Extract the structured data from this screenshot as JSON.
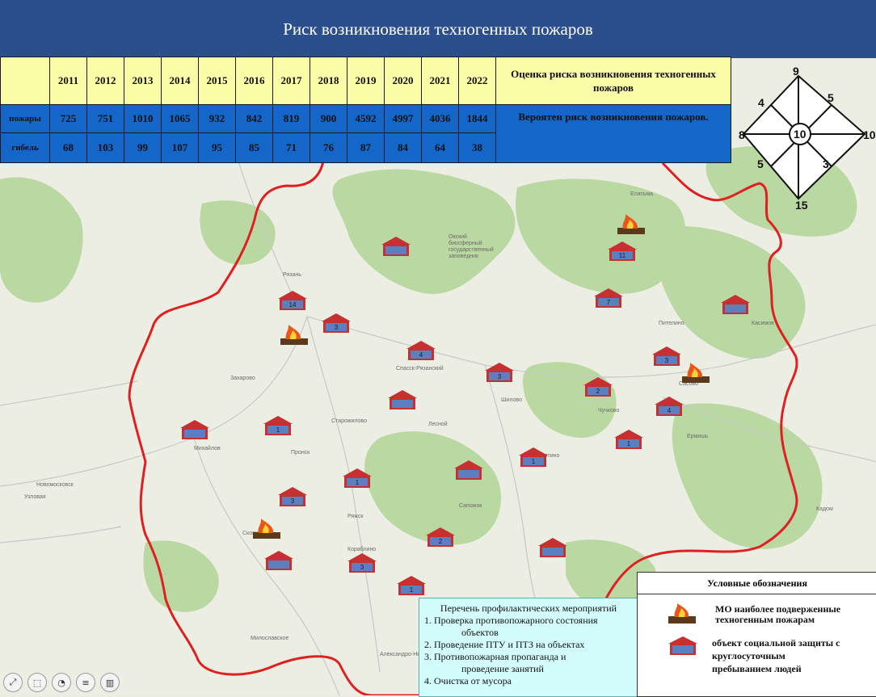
{
  "title": "Риск возникновения  техногенных пожаров",
  "table": {
    "years": [
      "2011",
      "2012",
      "2013",
      "2014",
      "2015",
      "2016",
      "2017",
      "2018",
      "2019",
      "2020",
      "2021",
      "2022"
    ],
    "rows": [
      {
        "label": "пожары",
        "values": [
          "725",
          "751",
          "1010",
          "1065",
          "932",
          "842",
          "819",
          "900",
          "4592",
          "4997",
          "4036",
          "1844"
        ]
      },
      {
        "label": "гибель",
        "values": [
          "68",
          "103",
          "99",
          "107",
          "95",
          "85",
          "71",
          "76",
          "87",
          "84",
          "64",
          "38"
        ]
      }
    ],
    "eval_title": "Оценка риска возникновения техногенных пожаров",
    "eval_value": "Вероятен риск возникновения пожаров."
  },
  "risk_rose": {
    "top": "9",
    "upper_left": "4",
    "upper_right": "5",
    "left": "8",
    "center": "10",
    "right": "10",
    "lower_left": "5",
    "lower_right": "3",
    "bottom": "15"
  },
  "map": {
    "reserve_label": [
      "Окский",
      "биосферный",
      "государственный",
      "заповедник"
    ],
    "places": [
      "Рязань",
      "Касимов",
      "Сасово",
      "Шилово",
      "Скопин",
      "Михайлов",
      "Новомосковск",
      "Узловая",
      "Захарово",
      "Старожилово",
      "Пронск",
      "Ряжск",
      "Сапожок",
      "Путятино",
      "Ермишь",
      "Кадом",
      "Пителино",
      "Елатьма",
      "Спасск-Рязанский",
      "Кораблино",
      "Милославское",
      "Александро-Невский",
      "Чучково",
      "Лесной"
    ],
    "markers": [
      {
        "kind": "social",
        "label": ""
      },
      {
        "kind": "social",
        "label": "11"
      },
      {
        "kind": "social",
        "label": "14"
      },
      {
        "kind": "social",
        "label": "3"
      },
      {
        "kind": "social",
        "label": "7"
      },
      {
        "kind": "social",
        "label": ""
      },
      {
        "kind": "social",
        "label": "4"
      },
      {
        "kind": "social",
        "label": "3"
      },
      {
        "kind": "social",
        "label": "3"
      },
      {
        "kind": "social",
        "label": "2"
      },
      {
        "kind": "social",
        "label": ""
      },
      {
        "kind": "social",
        "label": "4"
      },
      {
        "kind": "social",
        "label": "1"
      },
      {
        "kind": "social",
        "label": ""
      },
      {
        "kind": "social",
        "label": "1"
      },
      {
        "kind": "social",
        "label": "1"
      },
      {
        "kind": "social",
        "label": "1"
      },
      {
        "kind": "social",
        "label": ""
      },
      {
        "kind": "social",
        "label": "3"
      },
      {
        "kind": "social",
        "label": "2"
      },
      {
        "kind": "social",
        "label": ""
      },
      {
        "kind": "social",
        "label": ""
      },
      {
        "kind": "social",
        "label": "3"
      },
      {
        "kind": "social",
        "label": "1"
      },
      {
        "kind": "fire"
      },
      {
        "kind": "fire"
      },
      {
        "kind": "fire"
      },
      {
        "kind": "fire"
      }
    ]
  },
  "legend": {
    "title": "Условные обозначения",
    "fire_line1": "МО наиболее подверженные",
    "fire_line2": "техногенным пожарам",
    "social_line1": "объект социальной защиты с",
    "social_line2": "круглосуточным",
    "social_line3": "пребыванием  людей"
  },
  "measures": {
    "title_line1": "Перечень профилактических  мероприятий",
    "item1_a": "1. Проверка противопожарного состояния",
    "item1_b": "объектов",
    "item2": "2. Проведение ПТУ и ПТЗ на объектах",
    "item3_a": "3. Противопожарная пропаганда и",
    "item3_b": "проведение занятий",
    "item4": "4. Очистка от  мусора"
  },
  "toolbar": [
    "expand-icon",
    "selection-icon",
    "chart-icon",
    "list-icon",
    "table-icon"
  ],
  "colors": {
    "header": "#2b4e8c",
    "year_row": "#fbfca7",
    "data_row": "#1466c8",
    "border_line": "#e02020",
    "forest": "#b9d8a2",
    "legend_bg": "#ffffff",
    "measures_bg": "#d3fdfd"
  }
}
